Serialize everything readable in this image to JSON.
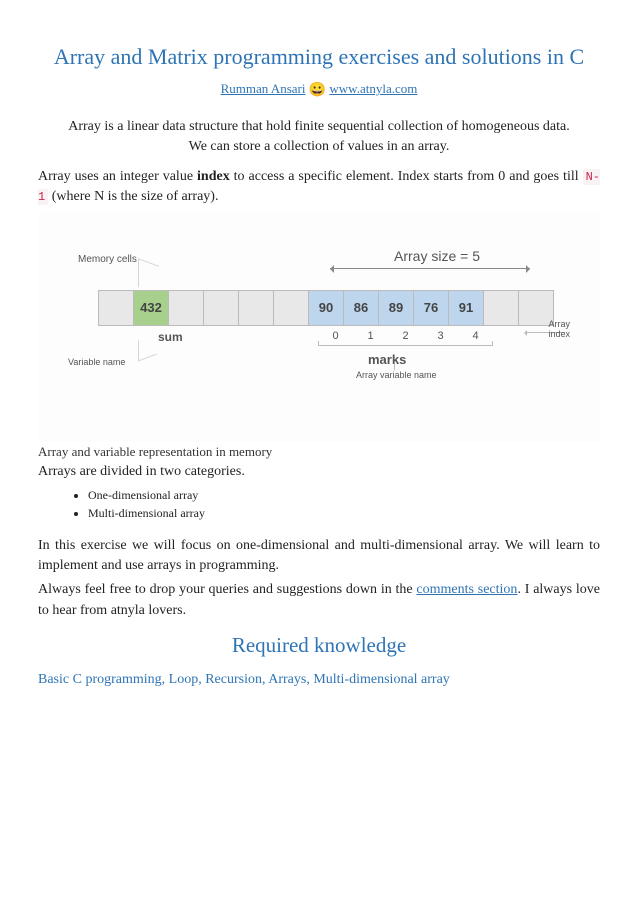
{
  "title": "Array and Matrix programming exercises and solutions in C",
  "author": {
    "name": "Rumman Ansari",
    "site": "www.atnyla.com"
  },
  "intro": "Array is a linear data structure that hold finite sequential collection of homogeneous data. We can store a collection of values in an array.",
  "para1_a": "Array uses an integer value ",
  "para1_b": "index",
  "para1_c": " to access a specific element. Index starts from 0 and goes till ",
  "para1_code": "N-1",
  "para1_d": " (where N is the size of array).",
  "diagram": {
    "memory_cells_label": "Memory cells",
    "size_label": "Array size = 5",
    "sum_value": "432",
    "sum_label": "sum",
    "variable_name_label": "Variable name",
    "array_values": [
      "90",
      "86",
      "89",
      "76",
      "91"
    ],
    "indices": [
      "0",
      "1",
      "2",
      "3",
      "4"
    ],
    "array_index_label": "Array\nindex",
    "marks_label": "marks",
    "array_var_name_label": "Array variable name"
  },
  "caption": "Array and variable representation in memory",
  "section": "Arrays are divided in two categories.",
  "cats": [
    "One-dimensional array",
    "Multi-dimensional array"
  ],
  "para2": "In this exercise we will focus on one-dimensional and multi-dimensional array. We will learn to implement and use arrays in programming.",
  "para3_a": "Always feel free to drop your queries and suggestions down in the ",
  "para3_link": "comments section",
  "para3_b": ". I always love to hear from atnyla lovers.",
  "h2": "Required knowledge",
  "kw": [
    "Basic C programming",
    "Loop",
    "Recursion",
    "Arrays",
    "Multi-dimensional array"
  ]
}
